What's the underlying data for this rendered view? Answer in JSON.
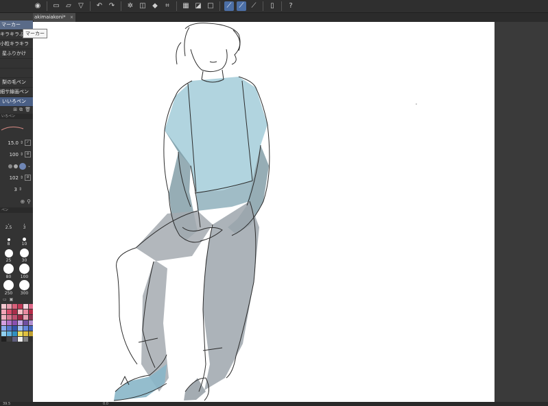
{
  "toolbar": {
    "icons": [
      "app-icon",
      "new-icon",
      "open-icon",
      "save-icon",
      "undo-icon",
      "redo-icon",
      "transform-icon",
      "lasso-icon",
      "fill-icon",
      "crop-icon",
      "grid-icon",
      "ruler-icon",
      "snap-icon",
      "pen-sel-icon",
      "pen-ruler-icon",
      "pen-pressure-icon",
      "tablet-icon",
      "help-icon"
    ]
  },
  "document_tab": {
    "title": "akimaiakoni*",
    "close": "×"
  },
  "tooltip": "マーカー",
  "left_panel": {
    "header": "マーカー",
    "sub_tools": [
      {
        "label": "キラキラふりかけ",
        "selected": false
      },
      {
        "label": "小粒キラキラ",
        "selected": false
      },
      {
        "label": "星ふりかけ",
        "selected": false
      },
      {
        "label": "",
        "selected": false
      },
      {
        "label": "",
        "selected": false
      },
      {
        "label": "梨の毛ペン",
        "selected": false
      },
      {
        "label": "細サ線画ペン",
        "selected": false
      },
      {
        "label": "いいろペン",
        "selected": true
      }
    ],
    "section_label": "いろペン",
    "properties": [
      {
        "value": "15.0"
      },
      {
        "value": "100"
      },
      {
        "value": ""
      },
      {
        "value": "102"
      },
      {
        "value": "3"
      }
    ],
    "brush_set_label": "ペン",
    "brush_sizes": [
      {
        "label": "2.5",
        "dot": 1
      },
      {
        "label": "3",
        "dot": 1
      },
      {
        "label": "8",
        "dot": 4
      },
      {
        "label": "10",
        "dot": 5
      },
      {
        "label": "25",
        "dot": 12
      },
      {
        "label": "30",
        "dot": 13
      },
      {
        "label": "80",
        "dot": 15
      },
      {
        "label": "100",
        "dot": 15
      },
      {
        "label": "250",
        "dot": 15
      },
      {
        "label": "300",
        "dot": 15
      }
    ],
    "palette_colors": [
      "#f3c6cf",
      "#e8a0b0",
      "#d9607a",
      "#c23a58",
      "#f5d6e0",
      "#e06a8a",
      "#f2a4b6",
      "#d94c6b",
      "#a82e4a",
      "#f7c1c8",
      "#e88aa0",
      "#b52d48",
      "#f0b0c0",
      "#d67a92",
      "#c05070",
      "#9b2a46",
      "#e7a2b4",
      "#8a3550",
      "#d4a0e0",
      "#b070c8",
      "#8a50b0",
      "#c8a8e8",
      "#7050a0",
      "#b090d0",
      "#88aaf0",
      "#5577cc",
      "#3355aa",
      "#a0c0f0",
      "#6688dd",
      "#4466bb",
      "#90d0f0",
      "#60b0e0",
      "#3090c0",
      "#f0e060",
      "#e0c040",
      "#c0a030",
      "#202020",
      "#404040",
      "#606080",
      "#f0f0f0",
      "#808080",
      "#303030"
    ]
  },
  "status": {
    "zoom": "39.5",
    "angle": "0.0"
  }
}
